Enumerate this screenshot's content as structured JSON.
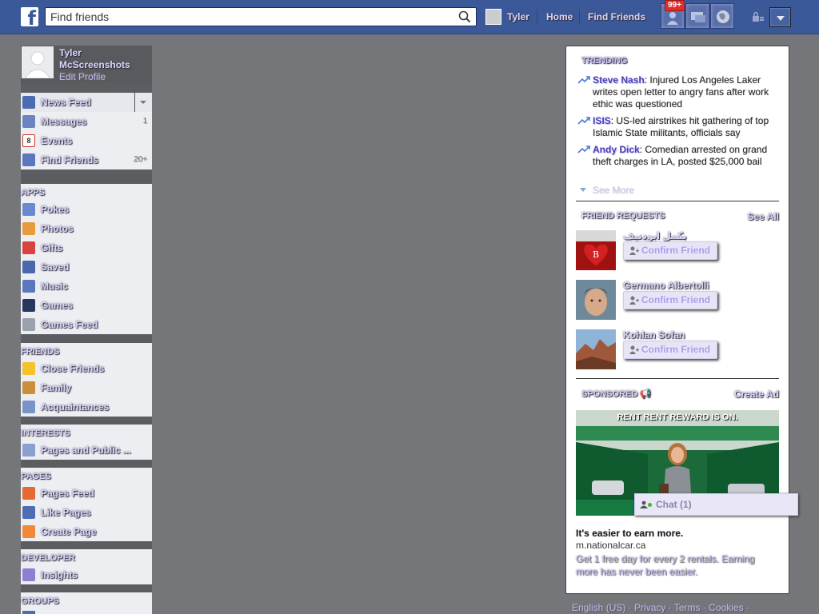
{
  "search": {
    "placeholder": "Find friends"
  },
  "topbar": {
    "user_name": "Tyler",
    "home": "Home",
    "find_friends": "Find Friends",
    "friend_requests_badge": "99+"
  },
  "profile": {
    "name": "Tyler McScreenshots",
    "edit": "Edit Profile"
  },
  "favorites": [
    {
      "label": "News Feed",
      "icon": "news-feed-icon",
      "count": ""
    },
    {
      "label": "Messages",
      "icon": "messages-icon",
      "count": "1"
    },
    {
      "label": "Events",
      "icon": "events-icon",
      "count": ""
    },
    {
      "label": "Find Friends",
      "icon": "find-friends-icon",
      "count": "20+"
    }
  ],
  "events_icon_text": "8",
  "apps": {
    "heading": "APPS",
    "items": [
      {
        "label": "Pokes",
        "icon": "pokes-icon"
      },
      {
        "label": "Photos",
        "icon": "photos-icon"
      },
      {
        "label": "Gifts",
        "icon": "gifts-icon"
      },
      {
        "label": "Saved",
        "icon": "saved-icon"
      },
      {
        "label": "Music",
        "icon": "music-icon"
      },
      {
        "label": "Games",
        "icon": "games-icon"
      },
      {
        "label": "Games Feed",
        "icon": "games-feed-icon"
      }
    ]
  },
  "friends": {
    "heading": "FRIENDS",
    "items": [
      {
        "label": "Close Friends",
        "icon": "star-icon"
      },
      {
        "label": "Family",
        "icon": "house-icon"
      },
      {
        "label": "Acquaintances",
        "icon": "acquaintances-icon"
      }
    ]
  },
  "interests": {
    "heading": "INTERESTS",
    "items": [
      {
        "label": "Pages and Public ...",
        "icon": "rss-icon"
      }
    ]
  },
  "pages": {
    "heading": "PAGES",
    "items": [
      {
        "label": "Pages Feed",
        "icon": "megaphone-icon"
      },
      {
        "label": "Like Pages",
        "icon": "thumbs-up-icon"
      },
      {
        "label": "Create Page",
        "icon": "plus-icon"
      }
    ]
  },
  "developer": {
    "heading": "DEVELOPER",
    "items": [
      {
        "label": "Insights",
        "icon": "chart-icon"
      }
    ]
  },
  "groups": {
    "heading": "GROUPS"
  },
  "trending": {
    "heading": "TRENDING",
    "items": [
      {
        "topic": "Steve Nash",
        "text": ": Injured Los Angeles Laker writes open letter to angry fans after work ethic was questioned"
      },
      {
        "topic": "ISIS",
        "text": ": US-led airstrikes hit gathering of top Islamic State militants, officials say"
      },
      {
        "topic": "Andy Dick",
        "text": ": Comedian arrested on grand theft charges in LA, posted $25,000 bail"
      }
    ],
    "see_more": "See More"
  },
  "friend_requests": {
    "heading": "FRIEND REQUESTS",
    "see_all": "See All",
    "confirm_label": "Confirm Friend",
    "people": [
      {
        "name": "بكمل ابودنيف"
      },
      {
        "name": "Germano Albertolli"
      },
      {
        "name": "Kohlan Sofan"
      }
    ]
  },
  "sponsored": {
    "heading": "SPONSORED",
    "create_ad": "Create Ad",
    "image_text": "RENT RENT REWARD IS ON.",
    "title": "It's easier to earn more.",
    "url": "m.nationalcar.ca",
    "description": "Get 1 free day for every 2 rentals. Earning more has never been easier."
  },
  "chat": {
    "label": "Chat (1)"
  },
  "footer": {
    "links": [
      "English (US)",
      "Privacy",
      "Terms",
      "Cookies"
    ],
    "separator": "·"
  },
  "colors": {
    "topbar": "#3b5998",
    "background": "#74767a",
    "link_purple": "#4a41b8",
    "badge_red": "#e02d2d"
  }
}
